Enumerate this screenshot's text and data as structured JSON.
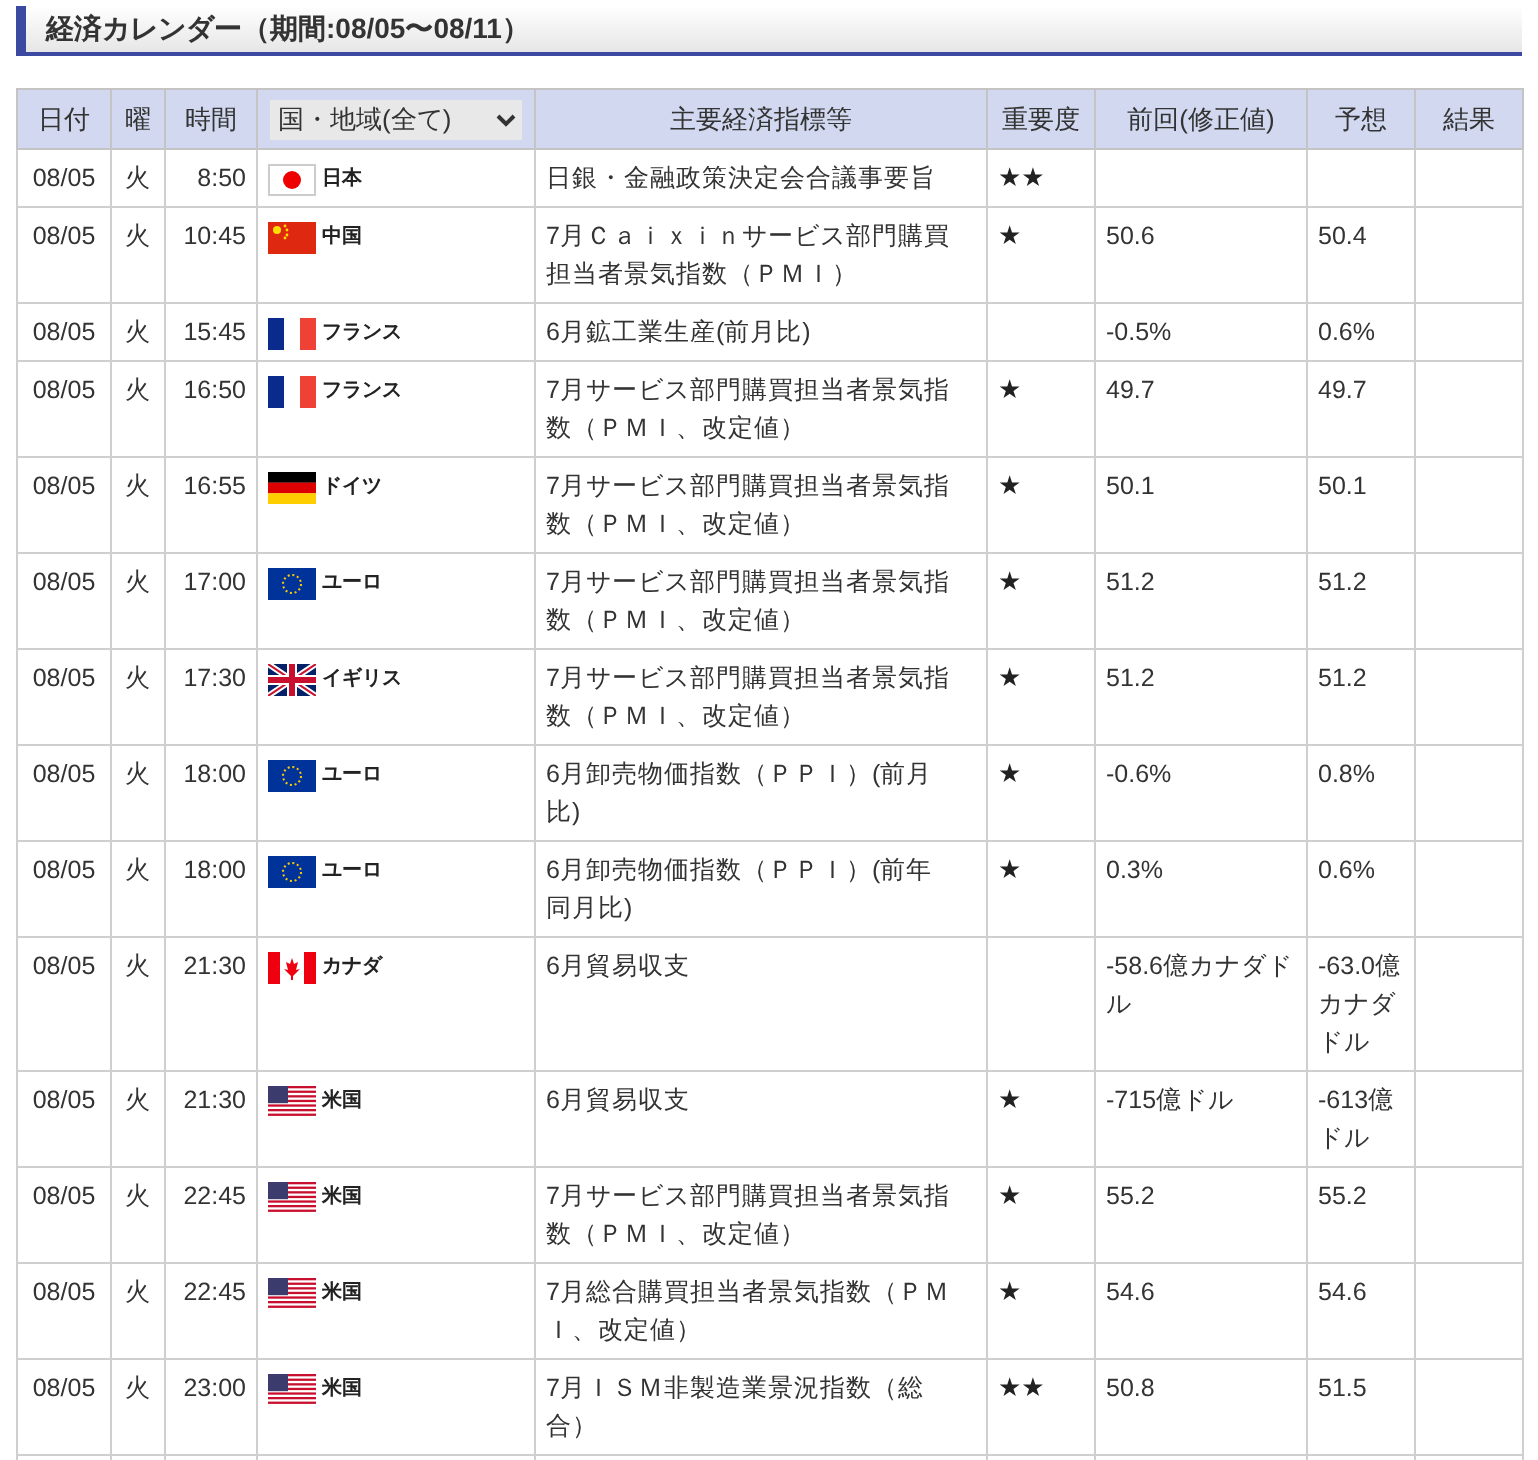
{
  "title": "経済カレンダー（期間:08/05〜08/11）",
  "columns": {
    "date": "日付",
    "weekday": "曜",
    "time": "時間",
    "region_select": "国・地域(全て)",
    "indicator": "主要経済指標等",
    "importance": "重要度",
    "previous": "前回(修正値)",
    "forecast": "予想",
    "result": "結果"
  },
  "rows": [
    {
      "date": "08/05",
      "weekday": "火",
      "time": "8:50",
      "kind": "jp",
      "country": "日本",
      "indicator": "日銀・金融政策決定会合議事要旨",
      "importance": "★★"
    },
    {
      "date": "08/05",
      "weekday": "火",
      "time": "10:45",
      "kind": "cn",
      "country": "中国",
      "indicator": "7月Ｃａｉｘｉｎサービス部門購買担当者景気指数（ＰＭＩ）",
      "importance": "★",
      "previous": "50.6",
      "forecast": "50.4"
    },
    {
      "date": "08/05",
      "weekday": "火",
      "time": "15:45",
      "kind": "fr",
      "country": "フランス",
      "indicator": "6月鉱工業生産(前月比)",
      "previous": "-0.5%",
      "forecast": "0.6%"
    },
    {
      "date": "08/05",
      "weekday": "火",
      "time": "16:50",
      "kind": "fr",
      "country": "フランス",
      "indicator": "7月サービス部門購買担当者景気指数（ＰＭＩ、改定値）",
      "importance": "★",
      "previous": "49.7",
      "forecast": "49.7"
    },
    {
      "date": "08/05",
      "weekday": "火",
      "time": "16:55",
      "kind": "de",
      "country": "ドイツ",
      "indicator": "7月サービス部門購買担当者景気指数（ＰＭＩ、改定値）",
      "importance": "★",
      "previous": "50.1",
      "forecast": "50.1"
    },
    {
      "date": "08/05",
      "weekday": "火",
      "time": "17:00",
      "kind": "eu",
      "country": "ユーロ",
      "indicator": "7月サービス部門購買担当者景気指数（ＰＭＩ、改定値）",
      "importance": "★",
      "previous": "51.2",
      "forecast": "51.2"
    },
    {
      "date": "08/05",
      "weekday": "火",
      "time": "17:30",
      "kind": "gb",
      "country": "イギリス",
      "indicator": "7月サービス部門購買担当者景気指数（ＰＭＩ、改定値）",
      "importance": "★",
      "previous": "51.2",
      "forecast": "51.2"
    },
    {
      "date": "08/05",
      "weekday": "火",
      "time": "18:00",
      "kind": "eu",
      "country": "ユーロ",
      "indicator": "6月卸売物価指数（ＰＰＩ）(前月比)",
      "importance": "★",
      "previous": "-0.6%",
      "forecast": "0.8%"
    },
    {
      "date": "08/05",
      "weekday": "火",
      "time": "18:00",
      "kind": "eu",
      "country": "ユーロ",
      "indicator": "6月卸売物価指数（ＰＰＩ）(前年同月比)",
      "importance": "★",
      "previous": "0.3%",
      "forecast": "0.6%"
    },
    {
      "date": "08/05",
      "weekday": "火",
      "time": "21:30",
      "kind": "ca",
      "country": "カナダ",
      "indicator": "6月貿易収支",
      "previous": "-58.6億カナダドル",
      "forecast": "-63.0億カナダドル"
    },
    {
      "date": "08/05",
      "weekday": "火",
      "time": "21:30",
      "kind": "us",
      "country": "米国",
      "indicator": "6月貿易収支",
      "importance": "★",
      "previous": "-715億ドル",
      "forecast": "-613億ドル"
    },
    {
      "date": "08/05",
      "weekday": "火",
      "time": "22:45",
      "kind": "us",
      "country": "米国",
      "indicator": "7月サービス部門購買担当者景気指数（ＰＭＩ、改定値）",
      "importance": "★",
      "previous": "55.2",
      "forecast": "55.2"
    },
    {
      "date": "08/05",
      "weekday": "火",
      "time": "22:45",
      "kind": "us",
      "country": "米国",
      "indicator": "7月総合購買担当者景気指数（ＰＭＩ、改定値）",
      "importance": "★",
      "previous": "54.6",
      "forecast": "54.6"
    },
    {
      "date": "08/05",
      "weekday": "火",
      "time": "23:00",
      "kind": "us",
      "country": "米国",
      "indicator": "7月ＩＳＭ非製造業景況指数（総合）",
      "importance": "★★",
      "previous": "50.8",
      "forecast": "51.5"
    }
  ]
}
